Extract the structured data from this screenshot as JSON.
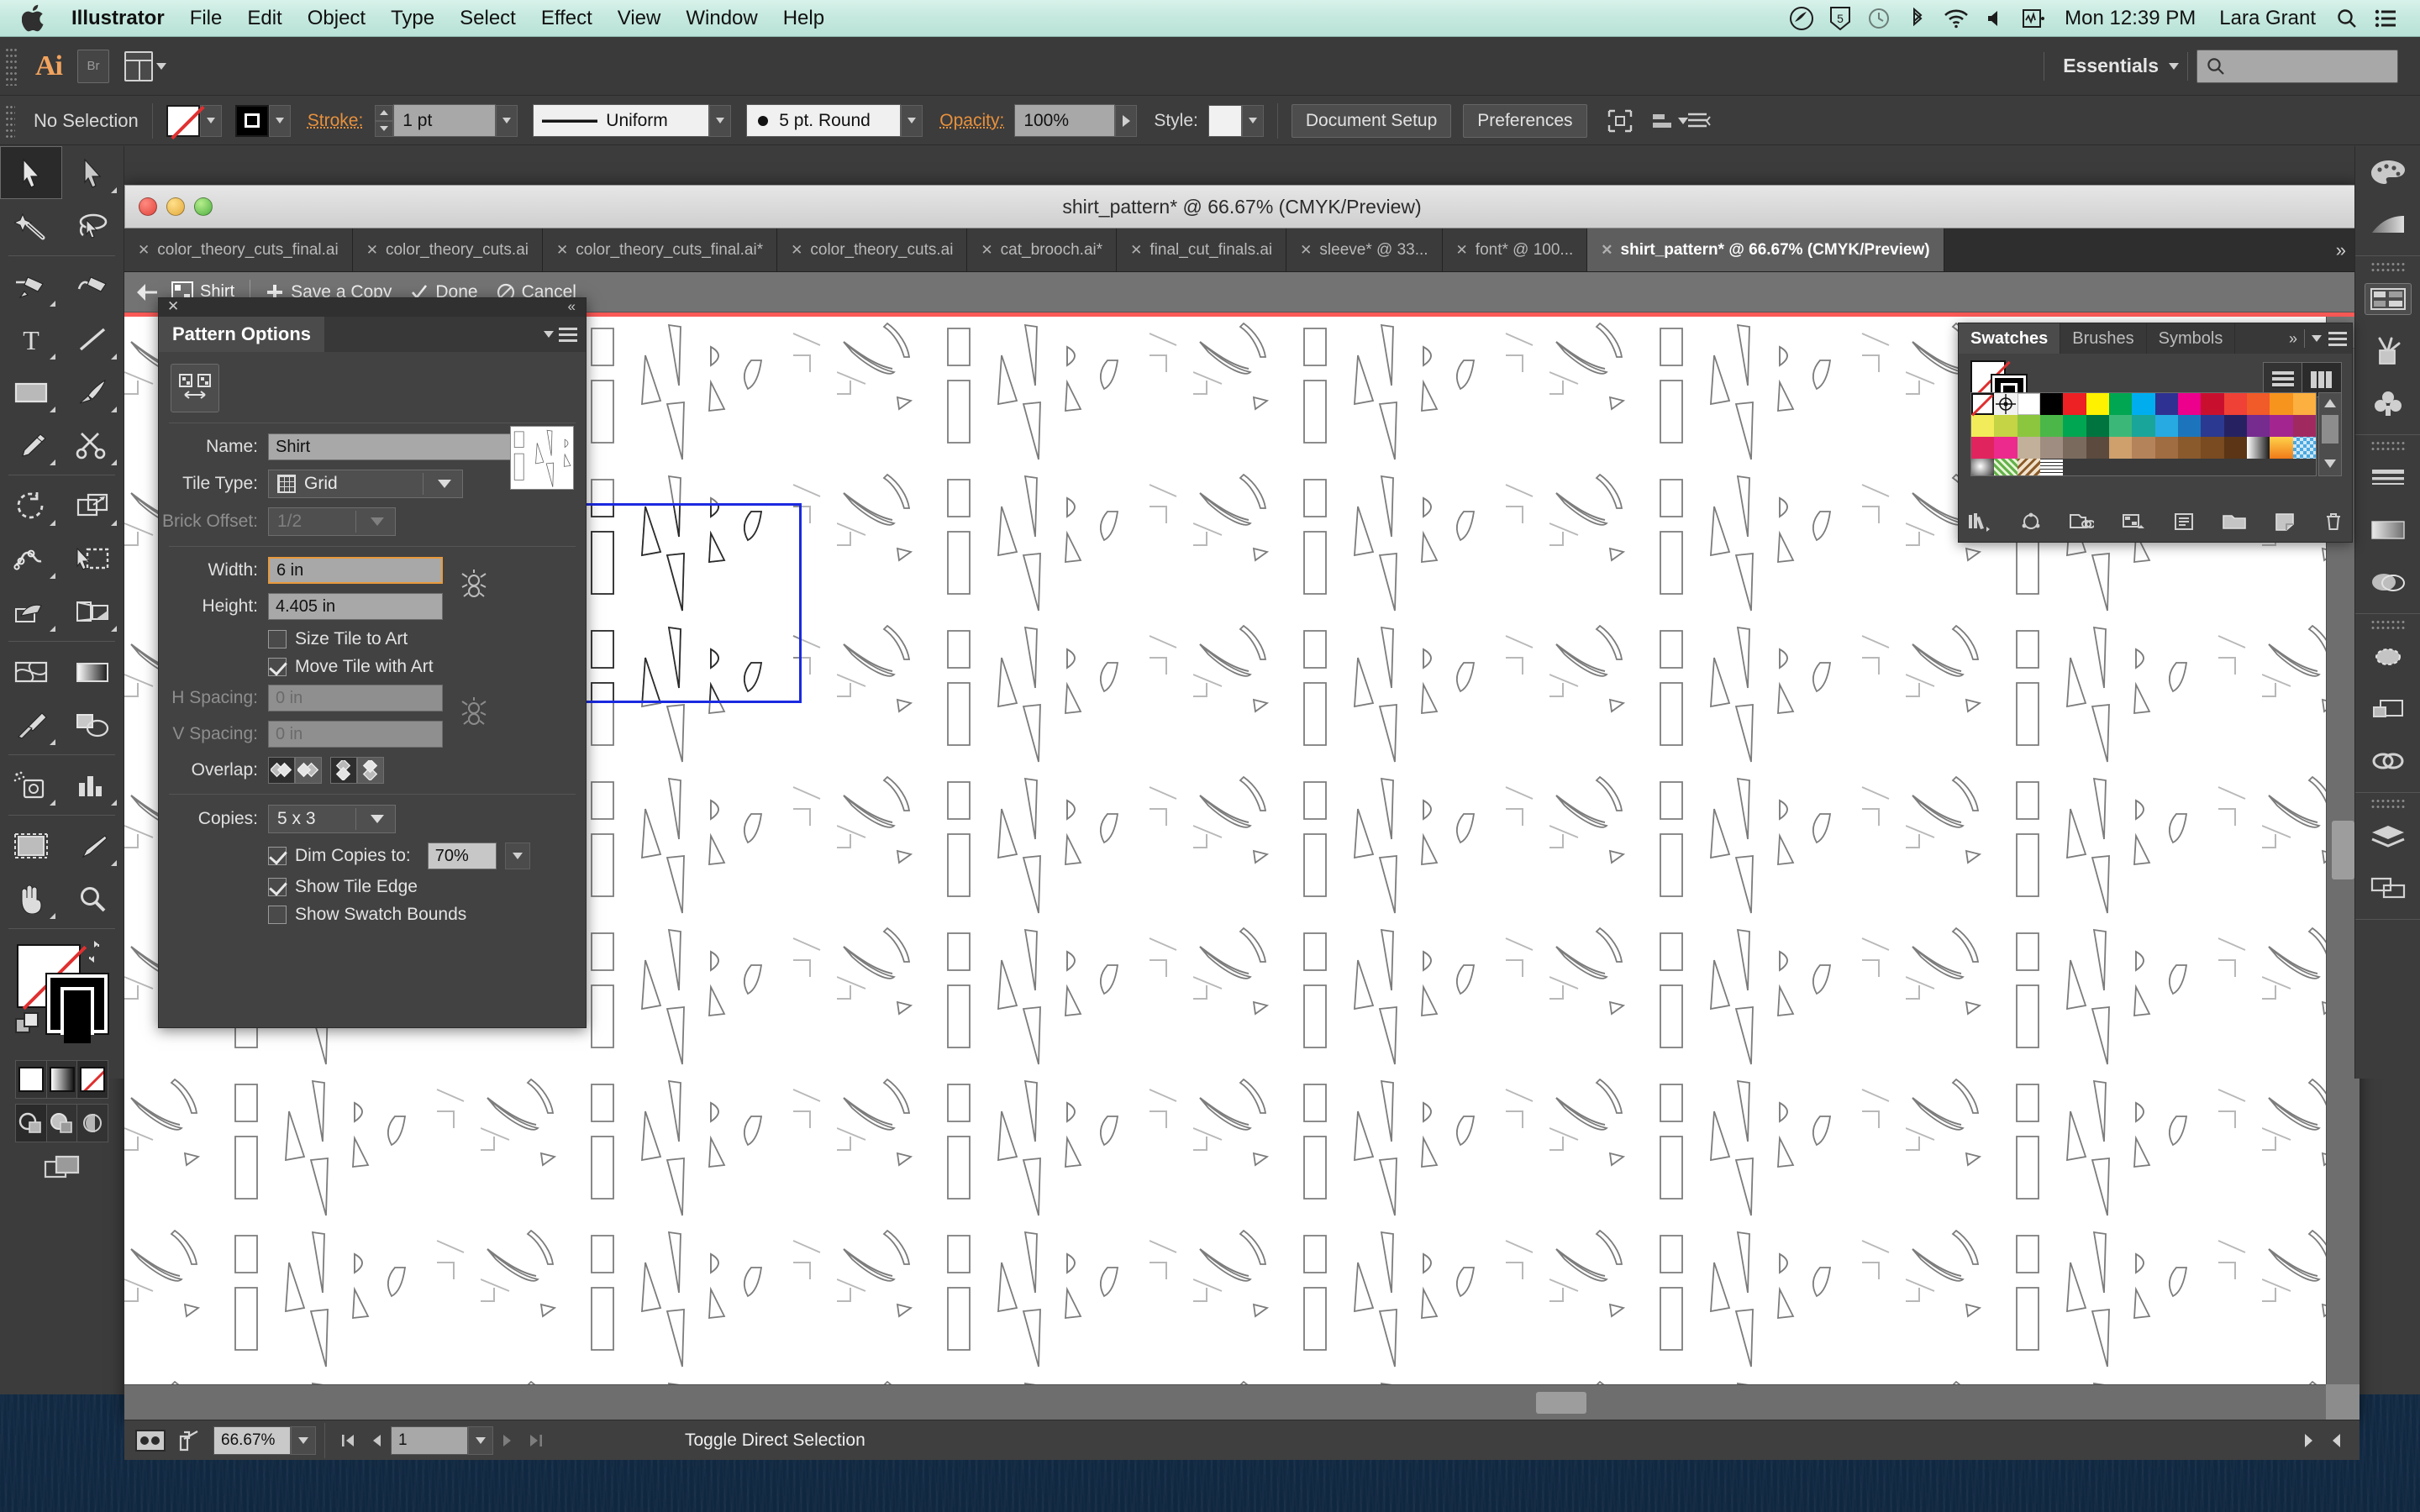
{
  "menubar": {
    "apple_icon": "apple-logo",
    "app_name": "Illustrator",
    "items": [
      "File",
      "Edit",
      "Object",
      "Type",
      "Select",
      "Effect",
      "View",
      "Window",
      "Help"
    ],
    "status_icons": [
      "creative-cloud-icon",
      "dropbox-icon",
      "timemachine-icon",
      "bluetooth-icon",
      "wifi-icon",
      "volume-icon",
      "activity-icon"
    ],
    "clock": "Mon 12:39 PM",
    "user": "Lara Grant",
    "search_icon": "spotlight-search-icon",
    "notification_icon": "notification-center-icon"
  },
  "apptop": {
    "logo": "Ai",
    "bridge_label": "Br",
    "arrange_label": "arrange-documents",
    "workspace": "Essentials",
    "search_placeholder": ""
  },
  "controlbar": {
    "selection_status": "No Selection",
    "fill_swatch": "none-swatch",
    "stroke_swatch": "black-stroke-swatch",
    "stroke_label": "Stroke:",
    "stroke_weight": "1 pt",
    "stroke_profile": "Uniform",
    "brush_definition": "5 pt. Round",
    "opacity_label": "Opacity:",
    "opacity_value": "100%",
    "style_label": "Style:",
    "document_setup": "Document Setup",
    "preferences": "Preferences"
  },
  "window": {
    "title": "shirt_pattern* @ 66.67% (CMYK/Preview)"
  },
  "tabs": [
    {
      "label": "color_theory_cuts_final.ai",
      "active": false
    },
    {
      "label": "color_theory_cuts.ai",
      "active": false
    },
    {
      "label": "color_theory_cuts_final.ai*",
      "active": false
    },
    {
      "label": "color_theory_cuts.ai",
      "active": false
    },
    {
      "label": "cat_brooch.ai*",
      "active": false
    },
    {
      "label": "final_cut_finals.ai",
      "active": false
    },
    {
      "label": "sleeve* @ 33...",
      "active": false
    },
    {
      "label": "font* @ 100...",
      "active": false
    },
    {
      "label": "shirt_pattern* @ 66.67% (CMYK/Preview)",
      "active": true
    }
  ],
  "tabs_overflow": "»",
  "pattern_bar": {
    "back_icon": "back-arrow-icon",
    "pattern_icon": "pattern-swatch-icon",
    "pattern_name": "Shirt",
    "save_copy": "Save a Copy",
    "done": "Done",
    "cancel": "Cancel"
  },
  "pattern_options": {
    "panel_title": "Pattern Options",
    "tile_tool_icon": "pattern-tile-tool-icon",
    "name_label": "Name:",
    "name_value": "Shirt",
    "tile_type_label": "Tile Type:",
    "tile_type_value": "Grid",
    "brick_offset_label": "Brick Offset:",
    "brick_offset_value": "1/2",
    "width_label": "Width:",
    "width_value": "6 in",
    "height_label": "Height:",
    "height_value": "4.405 in",
    "size_tile_to_art": {
      "label": "Size Tile to Art",
      "checked": false
    },
    "move_tile_with_art": {
      "label": "Move Tile with Art",
      "checked": true
    },
    "h_spacing_label": "H Spacing:",
    "h_spacing_value": "0 in",
    "v_spacing_label": "V Spacing:",
    "v_spacing_value": "0 in",
    "overlap_label": "Overlap:",
    "overlap_icons": [
      "overlap-right-in-front-icon",
      "overlap-left-in-front-icon",
      "overlap-bottom-in-front-icon",
      "overlap-top-in-front-icon"
    ],
    "overlap_selected": [
      0,
      2
    ],
    "copies_label": "Copies:",
    "copies_value": "5 x 3",
    "dim_copies": {
      "label": "Dim Copies to:",
      "checked": true,
      "value": "70%"
    },
    "show_tile_edge": {
      "label": "Show Tile Edge",
      "checked": true
    },
    "show_swatch_bounds": {
      "label": "Show Swatch Bounds",
      "checked": false
    },
    "link_icon": "constrain-proportions-icon"
  },
  "swatches_panel": {
    "tabs": [
      {
        "label": "Swatches",
        "active": true
      },
      {
        "label": "Brushes",
        "active": false
      },
      {
        "label": "Symbols",
        "active": false
      }
    ],
    "collapse_icon": "double-chevron-right-icon",
    "menu_icon": "panel-menu-icon",
    "view_list_icon": "list-view-icon",
    "view_grid_icon": "grid-view-icon",
    "fill_swatch": "none-swatch",
    "stroke_swatch": "black-stroke-swatch",
    "colors_row1": [
      "none",
      "registration",
      "#ffffff",
      "#000000",
      "#ed2024",
      "#fff200",
      "#00a651",
      "#00aeef",
      "#2e3192",
      "#ec008c",
      "#c8102e",
      "#ef4136",
      "#f15a29",
      "#f7941e",
      "#fbb040"
    ],
    "colors_row2": [
      "#f3ec5a",
      "#c4d444",
      "#8cc63f",
      "#4bb748",
      "#00a651",
      "#00743f",
      "#3bb878",
      "#1aa59a",
      "#27aae1",
      "#1c75bc",
      "#2b3990",
      "#262262",
      "#762b8f",
      "#a3258f",
      "#a02a60"
    ],
    "colors_row3": [
      "#e0245e",
      "#ec2a8d",
      "#c2b09a",
      "#a08d82",
      "#7a6a5e",
      "#5c4a3f",
      "#cf9f6c",
      "#b5835a",
      "#a06c42",
      "#8a5a2d",
      "#7a4a20",
      "#5c3516",
      "gradient-white-black",
      "gradient-yellow-orange",
      "pattern-blue-check"
    ],
    "colors_row4": [
      "gradient-sphere",
      "pattern-leaf",
      "pattern-scroll",
      "pattern-text"
    ],
    "footer_icons": [
      "swatch-libraries-icon",
      "color-group-icon",
      "cc-library-icon",
      "show-kinds-icon",
      "swatch-options-icon",
      "new-color-group-icon",
      "new-swatch-icon",
      "delete-swatch-icon"
    ]
  },
  "dock": {
    "groups": [
      [
        "color-panel-icon",
        "color-guide-icon"
      ],
      [
        "swatches-panel-icon",
        "brushes-panel-icon",
        "symbols-panel-icon"
      ],
      [
        "stroke-panel-icon",
        "gradient-panel-icon",
        "transparency-panel-icon"
      ],
      [
        "appearance-panel-icon",
        "graphic-styles-panel-icon",
        "cc-libraries-panel-icon"
      ],
      [
        "layers-panel-icon",
        "artboards-panel-icon"
      ]
    ]
  },
  "toolbar": {
    "tools": [
      "selection-tool",
      "direct-selection-tool",
      "magic-wand-tool",
      "lasso-tool",
      "pen-tool",
      "curvature-tool",
      "type-tool",
      "line-segment-tool",
      "rectangle-tool",
      "paintbrush-tool",
      "pencil-tool",
      "scissors-tool",
      "rotate-tool",
      "scale-tool",
      "width-tool",
      "free-transform-tool",
      "shape-builder-tool",
      "perspective-grid-tool",
      "mesh-tool",
      "gradient-tool",
      "eyedropper-tool",
      "blend-tool",
      "symbol-sprayer-tool",
      "column-graph-tool",
      "artboard-tool",
      "slice-tool",
      "hand-tool",
      "zoom-tool"
    ],
    "selected_tool": "selection-tool",
    "fill_swatch": "none-swatch",
    "stroke_swatch": "black-stroke-swatch",
    "swap_icon": "swap-fill-stroke-icon",
    "default_icon": "default-fill-stroke-icon",
    "mode_icons": [
      "color-mode-icon",
      "gradient-mode-icon",
      "none-mode-icon"
    ],
    "draw_modes": [
      "draw-normal-icon",
      "draw-behind-icon",
      "draw-inside-icon"
    ],
    "screen_mode_icon": "change-screen-mode-icon"
  },
  "statusbar": {
    "preview_icon": "pattern-preview-icon",
    "share_icon": "share-on-behance-icon",
    "zoom_value": "66.67%",
    "first_icon": "first-artboard-icon",
    "prev_icon": "previous-artboard-icon",
    "page_value": "1",
    "next_icon": "next-artboard-icon",
    "last_icon": "last-artboard-icon",
    "status_text": "Toggle Direct Selection"
  },
  "canvas": {
    "tile_edge_color": "#1b2ae0",
    "red_guide_color": "#fb5a57",
    "background": "#ffffff",
    "dim_copies_opacity": "70%"
  }
}
